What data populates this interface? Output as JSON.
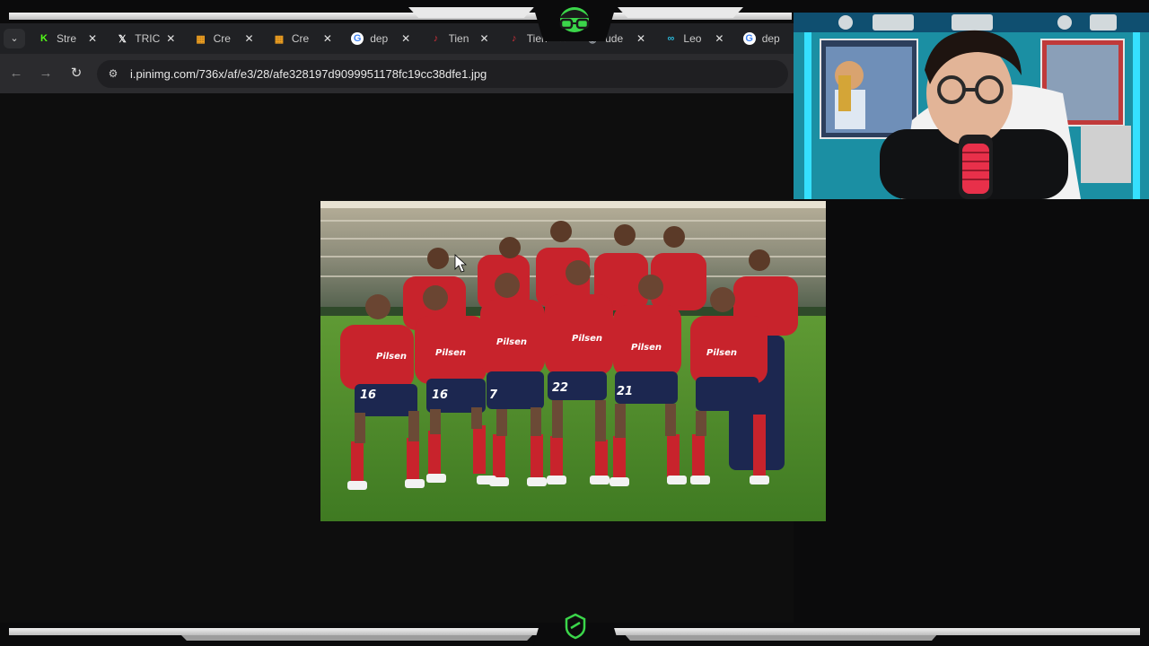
{
  "browser": {
    "tabs": [
      {
        "label": "Stre",
        "favicon": "kick-icon",
        "color": "#53fc18"
      },
      {
        "label": "TRIC",
        "favicon": "x-icon",
        "color": "#ffffff"
      },
      {
        "label": "Cre",
        "favicon": "sheet-icon",
        "color": "#f0a020"
      },
      {
        "label": "Cre",
        "favicon": "sheet-icon",
        "color": "#f0a020"
      },
      {
        "label": "dep",
        "favicon": "google-icon",
        "color": "#4285f4"
      },
      {
        "label": "Tien",
        "favicon": "music-icon",
        "color": "#d0303a"
      },
      {
        "label": "Tien",
        "favicon": "music-icon",
        "color": "#d0303a"
      },
      {
        "label": "ude",
        "favicon": "generic-icon",
        "color": "#9aa0a6"
      },
      {
        "label": "Leo",
        "favicon": "link-icon",
        "color": "#2bb7d8"
      },
      {
        "label": "dep",
        "favicon": "google-icon",
        "color": "#4285f4"
      }
    ],
    "tab_dropdown_label": "⌄",
    "tab_close_label": "✕",
    "nav": {
      "back": "←",
      "forward": "→",
      "reload": "↻",
      "site_info": "⚙"
    },
    "url": "i.pinimg.com/736x/af/e3/28/afe328197d9099951178fc19cc38dfe1.jpg"
  },
  "photo": {
    "jersey_numbers": [
      "16",
      "16",
      "7",
      "22",
      "21"
    ],
    "sponsor": "Pilsen"
  },
  "colors": {
    "kit_red": "#c8232c",
    "kit_navy": "#1c2750",
    "pitch_green": "#4f8a2c",
    "webcam_bg": "#1b8fa3"
  }
}
